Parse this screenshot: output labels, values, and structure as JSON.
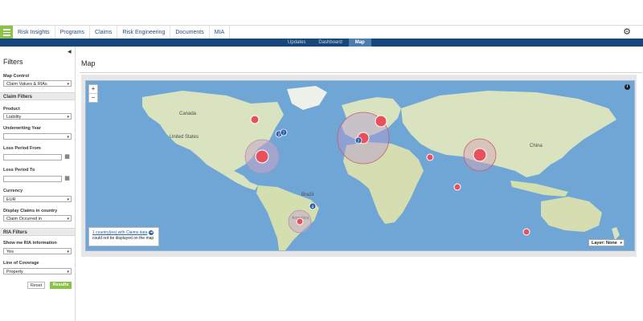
{
  "nav": {
    "tabs": [
      "Risk Insights",
      "Programs",
      "Claims",
      "Risk Engineering",
      "Documents",
      "MIA"
    ]
  },
  "subnav": {
    "tabs": [
      "Updates",
      "Dashboard",
      "Map"
    ],
    "active": "Map"
  },
  "sidebar": {
    "title": "Filters",
    "map_control": {
      "label": "Map Control",
      "value": "Claim Values & RIAs"
    },
    "claim_filters": {
      "heading": "Claim Filters",
      "product": {
        "label": "Product",
        "value": "Liability"
      },
      "underwriting_year": {
        "label": "Underwriting Year",
        "value": ""
      },
      "loss_period_from": {
        "label": "Loss Period From"
      },
      "loss_period_to": {
        "label": "Loss Period To"
      },
      "currency": {
        "label": "Currency",
        "value": "EUR"
      },
      "display_claims": {
        "label": "Display Claims in country",
        "value": "Claim Occurred in"
      }
    },
    "ria_filters": {
      "heading": "RIA Filters",
      "show_ria": {
        "label": "Show me RIA information",
        "value": "Yes"
      },
      "line_of_coverage": {
        "label": "Line of Coverage",
        "value": "Property"
      }
    },
    "reset_label": "Reset",
    "results_label": "Results"
  },
  "main": {
    "title": "Map",
    "zoom_in": "+",
    "zoom_out": "−",
    "info": "i",
    "note_link": "1 country(ies) with Claims data",
    "note_text": "could not be displayed on the map",
    "layer": "Layer: None"
  },
  "map": {
    "countries": [
      "Canada",
      "United States",
      "Brazil",
      "China",
      "Argentina"
    ],
    "markers": [
      {
        "label": "",
        "value": "3"
      },
      {
        "label": "",
        "value": "7"
      },
      {
        "label": "",
        "value": "2"
      },
      {
        "label": "",
        "value": "4"
      }
    ],
    "colors": {
      "ocean": "#6fa6d6",
      "land": "#d9e3bf",
      "circle": "#e8505b",
      "halo": "#c9a6c9"
    }
  }
}
